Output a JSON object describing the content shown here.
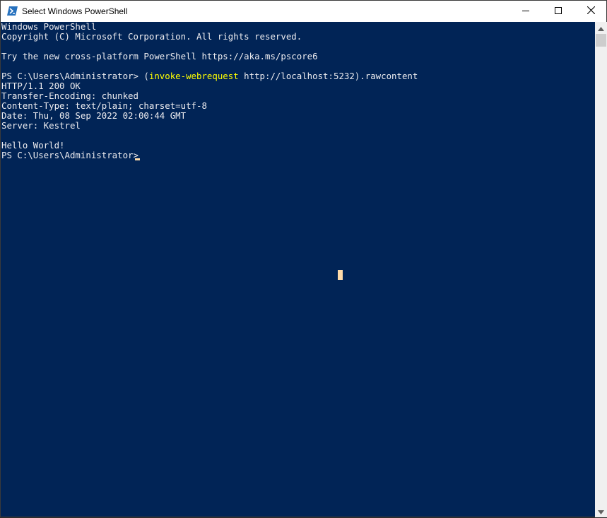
{
  "window": {
    "title": "Select Windows PowerShell",
    "icon": "powershell-icon",
    "controls": [
      "minimize-icon",
      "maximize-icon",
      "close-icon"
    ]
  },
  "console": {
    "lines": [
      "Windows PowerShell",
      "Copyright (C) Microsoft Corporation. All rights reserved.",
      "",
      "Try the new cross-platform PowerShell https://aka.ms/pscore6",
      "",
      "",
      "HTTP/1.1 200 OK",
      "Transfer-Encoding: chunked",
      "Content-Type: text/plain; charset=utf-8",
      "Date: Thu, 08 Sep 2022 02:00:44 GMT",
      "Server: Kestrel",
      "",
      "Hello World!"
    ],
    "command_prompt": "PS C:\\Users\\Administrator> (",
    "command_keyword": "invoke-webrequest",
    "command_rest": " http://localhost:5232).rawcontent",
    "final_prompt": "PS C:\\Users\\Administrator> "
  },
  "colors": {
    "background": "#012456",
    "foreground": "#eeedf0",
    "keyword": "#ffff00",
    "cursor": "#fedba9"
  }
}
